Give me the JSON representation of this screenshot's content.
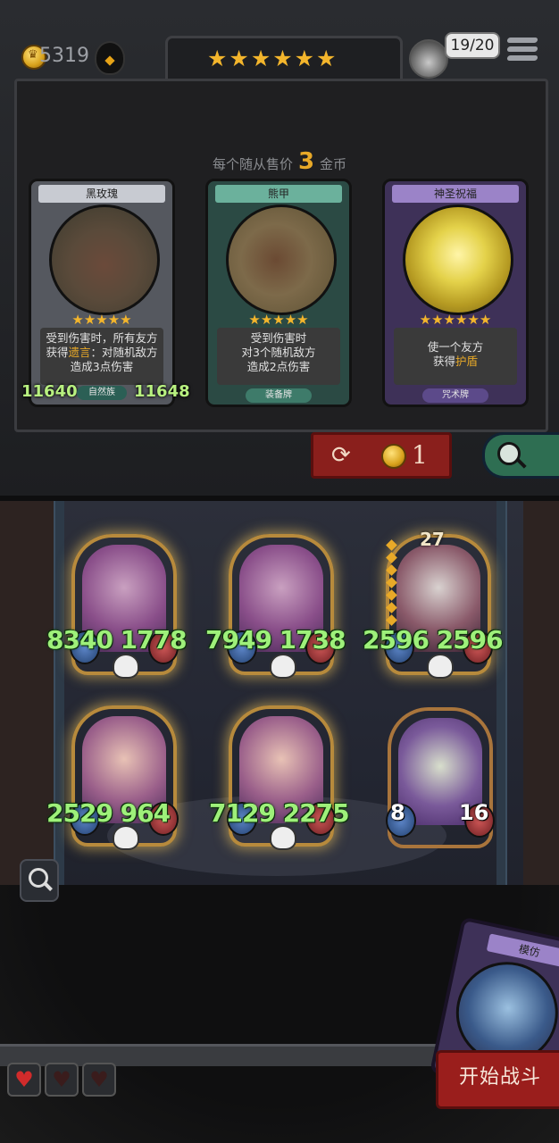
{
  "hud": {
    "gold": "5319",
    "tier_stars": "★★★★★★",
    "round_counter": "19/20"
  },
  "shop": {
    "sell_prefix": "每个随从售价",
    "sell_price": "3",
    "sell_suffix": "金币",
    "cards": [
      {
        "name": "黑玫瑰",
        "stars": "★★★★★",
        "desc_line1": "受到伤害时，所有友方",
        "desc_line2a": "获得",
        "desc_keyword": "遗言",
        "desc_line2b": "：对随机敌方",
        "desc_line3": "造成3点伤害",
        "type": "自然族",
        "attack": "11640",
        "health": "11648"
      },
      {
        "name": "熊甲",
        "stars": "★★★★★",
        "desc_line1": "受到伤害时",
        "desc_line2": "对3个随机敌方",
        "desc_line3": "造成2点伤害",
        "type": "装备牌"
      },
      {
        "name": "神圣祝福",
        "stars": "★★★★★★",
        "desc_line1": "使一个友方",
        "desc_line2a": "获得",
        "desc_keyword": "护盾",
        "type": "咒术牌"
      }
    ],
    "refresh_cost": "1"
  },
  "board": {
    "minions": [
      {
        "stats": "8340 1778"
      },
      {
        "stats": "7949 1738"
      },
      {
        "stats": "2596 2596",
        "level": "27"
      },
      {
        "stats": "2529 964"
      },
      {
        "stats": "7129 2275"
      },
      {
        "attack": "8",
        "health": "16"
      }
    ]
  },
  "hand": {
    "card_name": "模仿"
  },
  "actions": {
    "start_fight": "开始战斗"
  },
  "lives": {
    "full": 1,
    "total": 3
  }
}
